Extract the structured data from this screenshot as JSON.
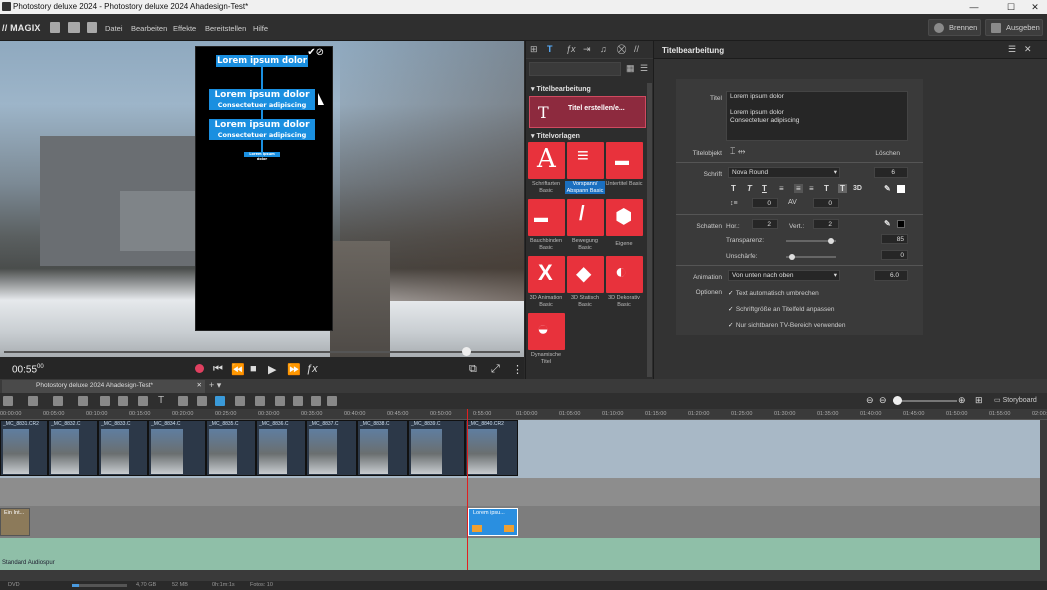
{
  "window": {
    "title": "Photostory deluxe 2024 - Photostory deluxe 2024 Ahadesign-Test*"
  },
  "menu": {
    "logo": "MAGIX",
    "items": [
      "Datei",
      "Bearbeiten",
      "Effekte",
      "Bereitstellen",
      "Hilfe"
    ],
    "burn": "Brennen",
    "output": "Ausgeben"
  },
  "preview": {
    "overlay": {
      "l1": "Lorem ipsum dolor",
      "l2a": "Lorem ipsum dolor",
      "l2b": "Consectetuer adipiscing",
      "l3a": "Lorem ipsum dolor",
      "l3b": "Consectetuer adipiscing",
      "l4": "Lorem ipsum dolor"
    },
    "timecode": "00:55",
    "timecode_frames": "00"
  },
  "media_pool": {
    "section_title": "Titelbearbeitung",
    "title_tile": "Titel erstellen/e...",
    "section_templates": "Titelvorlagen",
    "tiles": [
      {
        "label": "Schriftarten Basic",
        "glyph": "A"
      },
      {
        "label": "Vorspann/ Abspann Basic",
        "glyph": "≡"
      },
      {
        "label": "Untertitel Basic",
        "glyph": "▬"
      },
      {
        "label": "Bauchbinden Basic",
        "glyph": "▬"
      },
      {
        "label": "Bewegung Basic",
        "glyph": "/"
      },
      {
        "label": "Eigene",
        "glyph": "⬢"
      },
      {
        "label": "3D Animation Basic",
        "glyph": "X"
      },
      {
        "label": "3D Statisch Basic",
        "glyph": "◆"
      },
      {
        "label": "3D Dekorativ Basic",
        "glyph": "◐"
      },
      {
        "label": "Dynamische Titel",
        "glyph": "◒"
      }
    ]
  },
  "title_editor": {
    "header": "Titelbearbeitung",
    "title_label": "Titel",
    "title_text_1": "Lorem ipsum dolor",
    "title_text_2": "Lorem ipsum dolor",
    "title_text_3": "Consectetuer adipiscing",
    "object_label": "Titelobjekt",
    "delete": "Löschen",
    "font_label": "Schrift",
    "font_value": "Nova Round",
    "font_size": "6",
    "spacing_1": "0",
    "spacing_2": "0",
    "three_d": "3D",
    "shadow_label": "Schatten",
    "hor_label": "Hor.:",
    "hor_value": "2",
    "vert_label": "Vert.:",
    "vert_value": "2",
    "transparency_label": "Transparenz:",
    "transparency_value": "85",
    "blur_label": "Unschärfe:",
    "blur_value": "0",
    "animation_label": "Animation",
    "animation_value": "Von unten nach oben",
    "animation_speed": "6.0",
    "options_label": "Optionen",
    "opt1": "Text automatisch umbrechen",
    "opt2": "Schriftgröße an Titelfeld anpassen",
    "opt3": "Nur sichtbaren TV-Bereich verwenden"
  },
  "timeline": {
    "tab": "Photostory deluxe 2024 Ahadesign-Test*",
    "storyboard": "Storyboard",
    "ruler": [
      "00:00:00",
      "00:05:00",
      "00:10:00",
      "00:15:00",
      "00:20:00",
      "00:25:00",
      "00:30:00",
      "00:35:00",
      "00:40:00",
      "00:45:00",
      "00:50:00",
      "0:55:00",
      "01:00:00",
      "01:05:00",
      "01:10:00",
      "01:15:00",
      "01:20:00",
      "01:25:00",
      "01:30:00",
      "01:35:00",
      "01:40:00",
      "01:45:00",
      "01:50:00",
      "01:55:00",
      "02:00:00"
    ],
    "clips": [
      "_MC_8831.CR2",
      "_MC_8832.C",
      "_MC_8833.C",
      "_MC_8834.C",
      "_MC_8835.C",
      "_MC_8836.C",
      "_MC_8837.C",
      "_MC_8838.C",
      "_MC_8839.C",
      "_MC_8840.CR2"
    ],
    "intro_clip": "Ein Int...",
    "title_clip": "Lorem ipsu...",
    "audio_track": "Standard Audiospur",
    "status": {
      "disk": "DVD",
      "size": "4,70 GB",
      "mem": "52 MB",
      "duration": "0h:1m:1s",
      "fotos": "Fotos: 10"
    }
  }
}
